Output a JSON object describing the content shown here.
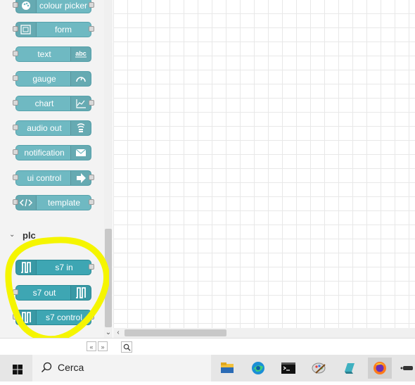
{
  "palette": {
    "nodes": [
      {
        "label": "colour picker",
        "icon": "palette-icon"
      },
      {
        "label": "form",
        "icon": "form-icon"
      },
      {
        "label": "text",
        "icon": "abc-icon"
      },
      {
        "label": "gauge",
        "icon": "gauge-icon"
      },
      {
        "label": "chart",
        "icon": "chart-icon"
      },
      {
        "label": "audio out",
        "icon": "speaker-icon"
      },
      {
        "label": "notification",
        "icon": "envelope-icon"
      },
      {
        "label": "ui control",
        "icon": "arrow-right-icon"
      },
      {
        "label": "template",
        "icon": "code-icon"
      }
    ],
    "category": {
      "label": "plc"
    },
    "plc_nodes": [
      {
        "label": "s7 in",
        "icon": "pulse-wave-icon"
      },
      {
        "label": "s7 out",
        "icon": "pulse-wave-icon"
      },
      {
        "label": "s7 control",
        "icon": "pulse-wave-icon"
      }
    ]
  },
  "footer": {
    "collapse_label": "«",
    "expand_label": "»"
  },
  "taskbar": {
    "search_text": "Cerca"
  },
  "colors": {
    "node": "#3ea6b3",
    "node_light": "#6fb9c2",
    "highlight": "#f5f500"
  }
}
